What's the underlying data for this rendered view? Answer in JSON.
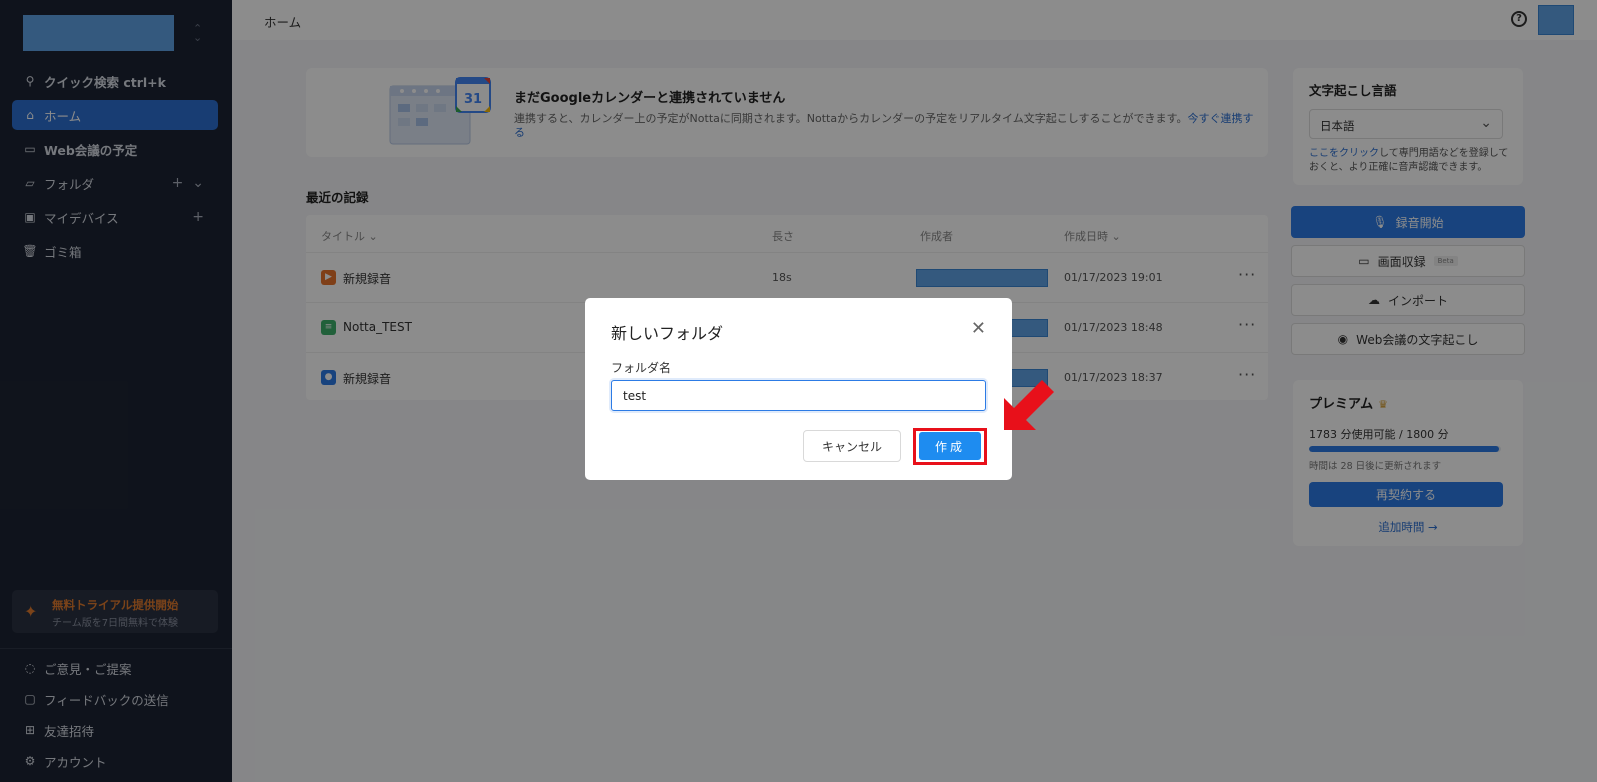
{
  "sidebar": {
    "quick_search": "クイック検索 ctrl+k",
    "items": [
      {
        "label": "ホーム",
        "icon": "home-icon"
      },
      {
        "label": "Web会議の予定",
        "icon": "calendar-icon"
      },
      {
        "label": "フォルダ",
        "icon": "folder-icon"
      },
      {
        "label": "マイデバイス",
        "icon": "device-icon"
      },
      {
        "label": "ゴミ箱",
        "icon": "trash-icon"
      }
    ],
    "trial": {
      "title": "無料トライアル提供開始",
      "subtitle": "チーム版を7日間無料で体験"
    },
    "footer_items": [
      {
        "label": "ご意見・ご提案",
        "icon": "lightbulb-icon"
      },
      {
        "label": "フィードバックの送信",
        "icon": "feedback-icon"
      },
      {
        "label": "友達招待",
        "icon": "gift-icon"
      },
      {
        "label": "アカウント",
        "icon": "gear-icon"
      }
    ]
  },
  "header": {
    "breadcrumb": "ホーム"
  },
  "calendar_banner": {
    "title": "まだGoogleカレンダーと連携されていません",
    "description": "連携すると、カレンダー上の予定がNottaに同期されます。Nottaからカレンダーの予定をリアルタイム文字起こしすることができます。",
    "link": "今すぐ連携する",
    "badge": "31"
  },
  "recent": {
    "title": "最近の記録",
    "columns": {
      "title": "タイトル",
      "length": "長さ",
      "author": "作成者",
      "date": "作成日時"
    },
    "rows": [
      {
        "name": "新規録音",
        "length": "18s",
        "date": "01/17/2023 19:01",
        "color": "#e8742c"
      },
      {
        "name": "Notta_TEST",
        "length": "",
        "date": "01/17/2023 18:48",
        "color": "#3daf6b"
      },
      {
        "name": "新規録音",
        "length": "",
        "date": "01/17/2023 18:37",
        "color": "#2c7be5"
      }
    ]
  },
  "language": {
    "title": "文字起こし言語",
    "selected": "日本語",
    "hint_link": "ここをクリック",
    "hint_text": "して専門用語などを登録しておくと、より正確に音声認識できます。"
  },
  "actions": {
    "record": "録音開始",
    "screen": "画面収録",
    "beta": "Beta",
    "import": "インポート",
    "web": "Web会議の文字起こし"
  },
  "premium": {
    "title": "プレミアム",
    "usage": "1783 分使用可能 / 1800 分",
    "usage_fraction": 0.99,
    "reset": "時間は 28 日後に更新されます",
    "renew": "再契約する",
    "add_time": "追加時間 →"
  },
  "modal": {
    "title": "新しいフォルダ",
    "field_label": "フォルダ名",
    "field_value": "test",
    "cancel": "キャンセル",
    "create": "作成"
  },
  "colors": {
    "accent": "#2c7be5",
    "sidebar": "#1d2433",
    "highlight": "#e8101a"
  }
}
